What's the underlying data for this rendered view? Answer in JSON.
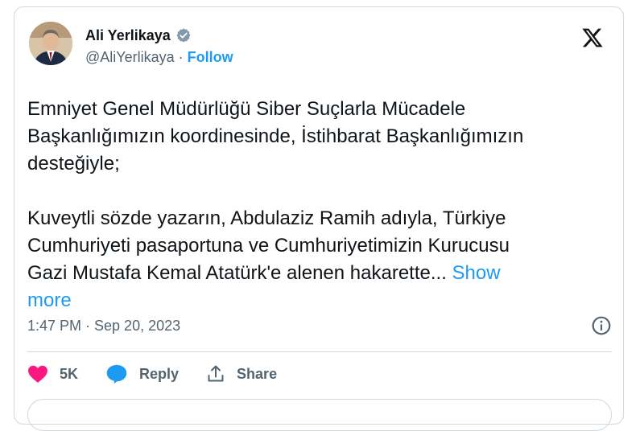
{
  "author": {
    "name": "Ali Yerlikaya",
    "handle": "@AliYerlikaya",
    "separator": "·",
    "follow_label": "Follow"
  },
  "icons": {
    "verified": "verified-badge-icon",
    "logo": "x-logo-icon",
    "info": "info-icon",
    "like": "heart-icon",
    "reply": "speech-bubble-icon",
    "share": "share-upload-icon"
  },
  "tweet": {
    "text": "Emniyet Genel Müdürlüğü Siber Suçlarla Mücadele\nBaşkanlığımızın koordinesinde, İstihbarat Başkanlığımızın\ndesteğiyle;\n\nKuveytli sözde yazarın, Abdulaziz Ramih adıyla, Türkiye\nCumhuriyeti pasaportuna ve Cumhuriyetimizin Kurucusu\nGazi Mustafa Kemal Atatürk'e alenen hakarette... ",
    "show_more_label": "Show\nmore",
    "timestamp": "1:47 PM · Sep 20, 2023"
  },
  "actions": {
    "like_count": "5K",
    "reply_label": "Reply",
    "share_label": "Share"
  },
  "colors": {
    "accent": "#1d9bf0",
    "like": "#f91880",
    "muted": "#536471",
    "border": "#cfd9de"
  }
}
